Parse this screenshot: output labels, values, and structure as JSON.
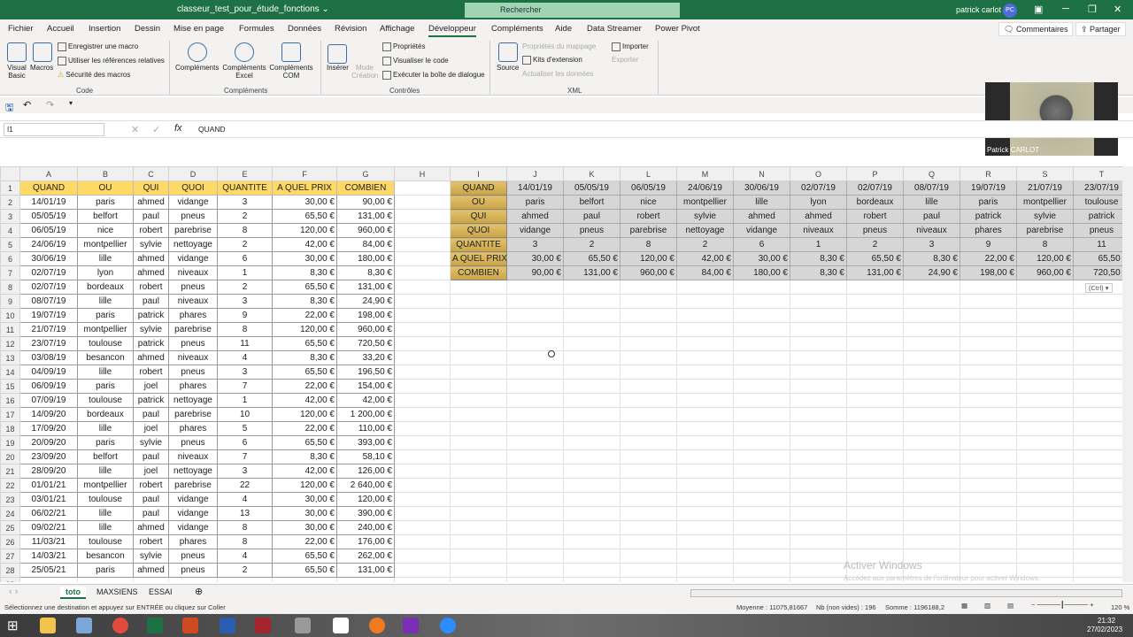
{
  "titlebar": {
    "title": "classeur_test_pour_étude_fonctions ⌄",
    "search": "Rechercher",
    "user": "patrick carlot",
    "avatar": "PC"
  },
  "menu": [
    "Fichier",
    "Accueil",
    "Insertion",
    "Dessin",
    "Mise en page",
    "Formules",
    "Données",
    "Révision",
    "Affichage",
    "Développeur",
    "Compléments",
    "Aide",
    "Data Streamer",
    "Power Pivot"
  ],
  "menu_active": "Développeur",
  "topbuttons": {
    "comments": "Commentaires",
    "share": "Partager"
  },
  "ribbon": {
    "code": {
      "label": "Code",
      "visual_basic": "Visual Basic",
      "macros": "Macros",
      "record": "Enregistrer une macro",
      "relative": "Utiliser les références relatives",
      "security": "Sécurité des macros"
    },
    "addins": {
      "label": "Compléments",
      "addins": "Compléments",
      "excel": "Compléments Excel",
      "com": "Compléments COM"
    },
    "controls": {
      "label": "Contrôles",
      "insert": "Insérer",
      "design": "Mode Création",
      "properties": "Propriétés",
      "view_code": "Visualiser le code",
      "dialog": "Exécuter la boîte de dialogue"
    },
    "xml": {
      "label": "XML",
      "source": "Source",
      "map_props": "Propriétés du mappage",
      "packs": "Kits d'extension",
      "refresh": "Actualiser les données",
      "import": "Importer",
      "export": "Exporter"
    }
  },
  "formula": {
    "namebox": "I1",
    "content": "QUAND"
  },
  "webcam": {
    "name": "Patrick CARLOT"
  },
  "columns": [
    "A",
    "B",
    "C",
    "D",
    "E",
    "F",
    "G",
    "H",
    "I",
    "J",
    "K",
    "L",
    "M",
    "N",
    "O",
    "P",
    "Q",
    "R",
    "S",
    "T"
  ],
  "headers": [
    "QUAND",
    "OU",
    "QUI",
    "QUOI",
    "QUANTITE",
    "A QUEL PRIX",
    "COMBIEN"
  ],
  "rows": [
    [
      "14/01/19",
      "paris",
      "ahmed",
      "vidange",
      "3",
      "30,00 €",
      "90,00 €"
    ],
    [
      "05/05/19",
      "belfort",
      "paul",
      "pneus",
      "2",
      "65,50 €",
      "131,00 €"
    ],
    [
      "06/05/19",
      "nice",
      "robert",
      "parebrise",
      "8",
      "120,00 €",
      "960,00 €"
    ],
    [
      "24/06/19",
      "montpellier",
      "sylvie",
      "nettoyage",
      "2",
      "42,00 €",
      "84,00 €"
    ],
    [
      "30/06/19",
      "lille",
      "ahmed",
      "vidange",
      "6",
      "30,00 €",
      "180,00 €"
    ],
    [
      "02/07/19",
      "lyon",
      "ahmed",
      "niveaux",
      "1",
      "8,30 €",
      "8,30 €"
    ],
    [
      "02/07/19",
      "bordeaux",
      "robert",
      "pneus",
      "2",
      "65,50 €",
      "131,00 €"
    ],
    [
      "08/07/19",
      "lille",
      "paul",
      "niveaux",
      "3",
      "8,30 €",
      "24,90 €"
    ],
    [
      "19/07/19",
      "paris",
      "patrick",
      "phares",
      "9",
      "22,00 €",
      "198,00 €"
    ],
    [
      "21/07/19",
      "montpellier",
      "sylvie",
      "parebrise",
      "8",
      "120,00 €",
      "960,00 €"
    ],
    [
      "23/07/19",
      "toulouse",
      "patrick",
      "pneus",
      "11",
      "65,50 €",
      "720,50 €"
    ],
    [
      "03/08/19",
      "besancon",
      "ahmed",
      "niveaux",
      "4",
      "8,30 €",
      "33,20 €"
    ],
    [
      "04/09/19",
      "lille",
      "robert",
      "pneus",
      "3",
      "65,50 €",
      "196,50 €"
    ],
    [
      "06/09/19",
      "paris",
      "joel",
      "phares",
      "7",
      "22,00 €",
      "154,00 €"
    ],
    [
      "07/09/19",
      "toulouse",
      "patrick",
      "nettoyage",
      "1",
      "42,00 €",
      "42,00 €"
    ],
    [
      "14/09/20",
      "bordeaux",
      "paul",
      "parebrise",
      "10",
      "120,00 €",
      "1 200,00 €"
    ],
    [
      "17/09/20",
      "lille",
      "joel",
      "phares",
      "5",
      "22,00 €",
      "110,00 €"
    ],
    [
      "20/09/20",
      "paris",
      "sylvie",
      "pneus",
      "6",
      "65,50 €",
      "393,00 €"
    ],
    [
      "23/09/20",
      "belfort",
      "paul",
      "niveaux",
      "7",
      "8,30 €",
      "58,10 €"
    ],
    [
      "28/09/20",
      "lille",
      "joel",
      "nettoyage",
      "3",
      "42,00 €",
      "126,00 €"
    ],
    [
      "01/01/21",
      "montpellier",
      "robert",
      "parebrise",
      "22",
      "120,00 €",
      "2 640,00 €"
    ],
    [
      "03/01/21",
      "toulouse",
      "paul",
      "vidange",
      "4",
      "30,00 €",
      "120,00 €"
    ],
    [
      "06/02/21",
      "lille",
      "paul",
      "vidange",
      "13",
      "30,00 €",
      "390,00 €"
    ],
    [
      "09/02/21",
      "lille",
      "ahmed",
      "vidange",
      "8",
      "30,00 €",
      "240,00 €"
    ],
    [
      "11/03/21",
      "toulouse",
      "robert",
      "phares",
      "8",
      "22,00 €",
      "176,00 €"
    ],
    [
      "14/03/21",
      "besancon",
      "sylvie",
      "pneus",
      "4",
      "65,50 €",
      "262,00 €"
    ],
    [
      "25/05/21",
      "paris",
      "ahmed",
      "pneus",
      "2",
      "65,50 €",
      "131,00 €"
    ]
  ],
  "transposed_visible_columns": 11,
  "paste_options": "(Ctrl) ▾",
  "sheets": [
    "toto",
    "MAXSIENS",
    "ESSAI"
  ],
  "active_sheet": "toto",
  "status": {
    "message": "Sélectionnez une destination et appuyez sur ENTRÉE ou cliquez sur Coller",
    "average": "Moyenne : 11075,81667",
    "count": "Nb (non vides) : 196",
    "sum": "Somme : 1196188,2",
    "zoom": "120 %"
  },
  "watermark": {
    "title": "Activer Windows",
    "sub": "Accédez aux paramètres de l'ordinateur pour activer Windows."
  },
  "taskbar": {
    "time": "21:32",
    "date": "27/02/2023"
  },
  "colors": {
    "excel_green": "#1e7145",
    "header_gold": "#ffd966",
    "transposed_gray": "#d6d6d6"
  }
}
